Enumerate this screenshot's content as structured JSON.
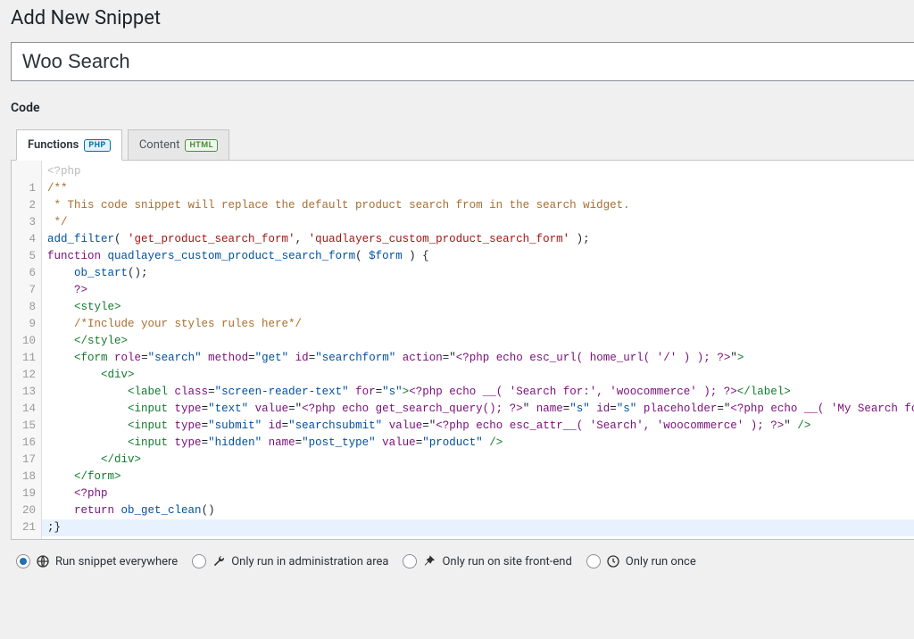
{
  "page": {
    "title": "Add New Snippet",
    "snippet_name": "Woo Search",
    "code_label": "Code"
  },
  "tabs": {
    "functions": {
      "label": "Functions",
      "badge": "PHP",
      "active": true
    },
    "content": {
      "label": "Content",
      "badge": "HTML",
      "active": false
    }
  },
  "editor": {
    "start_line": "<?php",
    "lines": [
      {
        "n": 1,
        "type": "comment",
        "text": "/**"
      },
      {
        "n": 2,
        "type": "comment",
        "text": " * This code snippet will replace the default product search from in the search widget."
      },
      {
        "n": 3,
        "type": "comment",
        "text": " */"
      },
      {
        "n": 4,
        "type": "phpcall",
        "fn": "add_filter",
        "args": [
          "'get_product_search_form'",
          "'quadlayers_custom_product_search_form'"
        ]
      },
      {
        "n": 5,
        "type": "funcdef",
        "name": "quadlayers_custom_product_search_form",
        "param": "$form"
      },
      {
        "n": 6,
        "type": "phpstmt",
        "indent": "    ",
        "text": "ob_start();"
      },
      {
        "n": 7,
        "type": "phpclose",
        "indent": "    ",
        "text": "?>"
      },
      {
        "n": 8,
        "type": "tagopen",
        "indent": "    ",
        "tag": "style"
      },
      {
        "n": 9,
        "type": "csscomment",
        "indent": "    ",
        "text": "/*Include your styles rules here*/"
      },
      {
        "n": 10,
        "type": "tagclose",
        "indent": "    ",
        "tag": "style"
      },
      {
        "n": 11,
        "type": "form",
        "indent": "    "
      },
      {
        "n": 12,
        "type": "divopen",
        "indent": "        "
      },
      {
        "n": 13,
        "type": "label",
        "indent": "            "
      },
      {
        "n": 14,
        "type": "input_text",
        "indent": "            "
      },
      {
        "n": 15,
        "type": "input_submit",
        "indent": "            "
      },
      {
        "n": 16,
        "type": "input_hidden",
        "indent": "            "
      },
      {
        "n": 17,
        "type": "divclose",
        "indent": "        "
      },
      {
        "n": 18,
        "type": "tagclose",
        "indent": "    ",
        "tag": "form"
      },
      {
        "n": 19,
        "type": "phpopen",
        "indent": "    ",
        "text": "<?php"
      },
      {
        "n": 20,
        "type": "return",
        "indent": "    ",
        "text": "ob_get_clean()"
      },
      {
        "n": 21,
        "type": "funcend",
        "text": ";}",
        "active": true
      }
    ],
    "tokens": {
      "form_role": "search",
      "form_method": "get",
      "form_id": "searchform",
      "form_action_php": "<?php echo esc_url( home_url( '/' ) ); ?>",
      "label_class": "screen-reader-text",
      "label_for": "s",
      "label_php": "<?php echo __( 'Search for:', 'woocommerce' ); ?>",
      "input_text_name": "s",
      "input_text_id": "s",
      "input_text_value_php": "<?php echo get_search_query(); ?>",
      "input_text_placeholder_php": "<?php echo __( 'My Search form', 'woocommerce' ); ?>",
      "input_submit_id": "searchsubmit",
      "input_submit_value_php": "<?php echo esc_attr__( 'Search', 'woocommerce' ); ?>",
      "input_hidden_name": "post_type",
      "input_hidden_value": "product"
    }
  },
  "scope": {
    "selected": "everywhere",
    "options": [
      {
        "id": "everywhere",
        "label": "Run snippet everywhere",
        "icon": "globe"
      },
      {
        "id": "admin",
        "label": "Only run in administration area",
        "icon": "wrench"
      },
      {
        "id": "frontend",
        "label": "Only run on site front-end",
        "icon": "pin"
      },
      {
        "id": "once",
        "label": "Only run once",
        "icon": "clock"
      }
    ]
  }
}
